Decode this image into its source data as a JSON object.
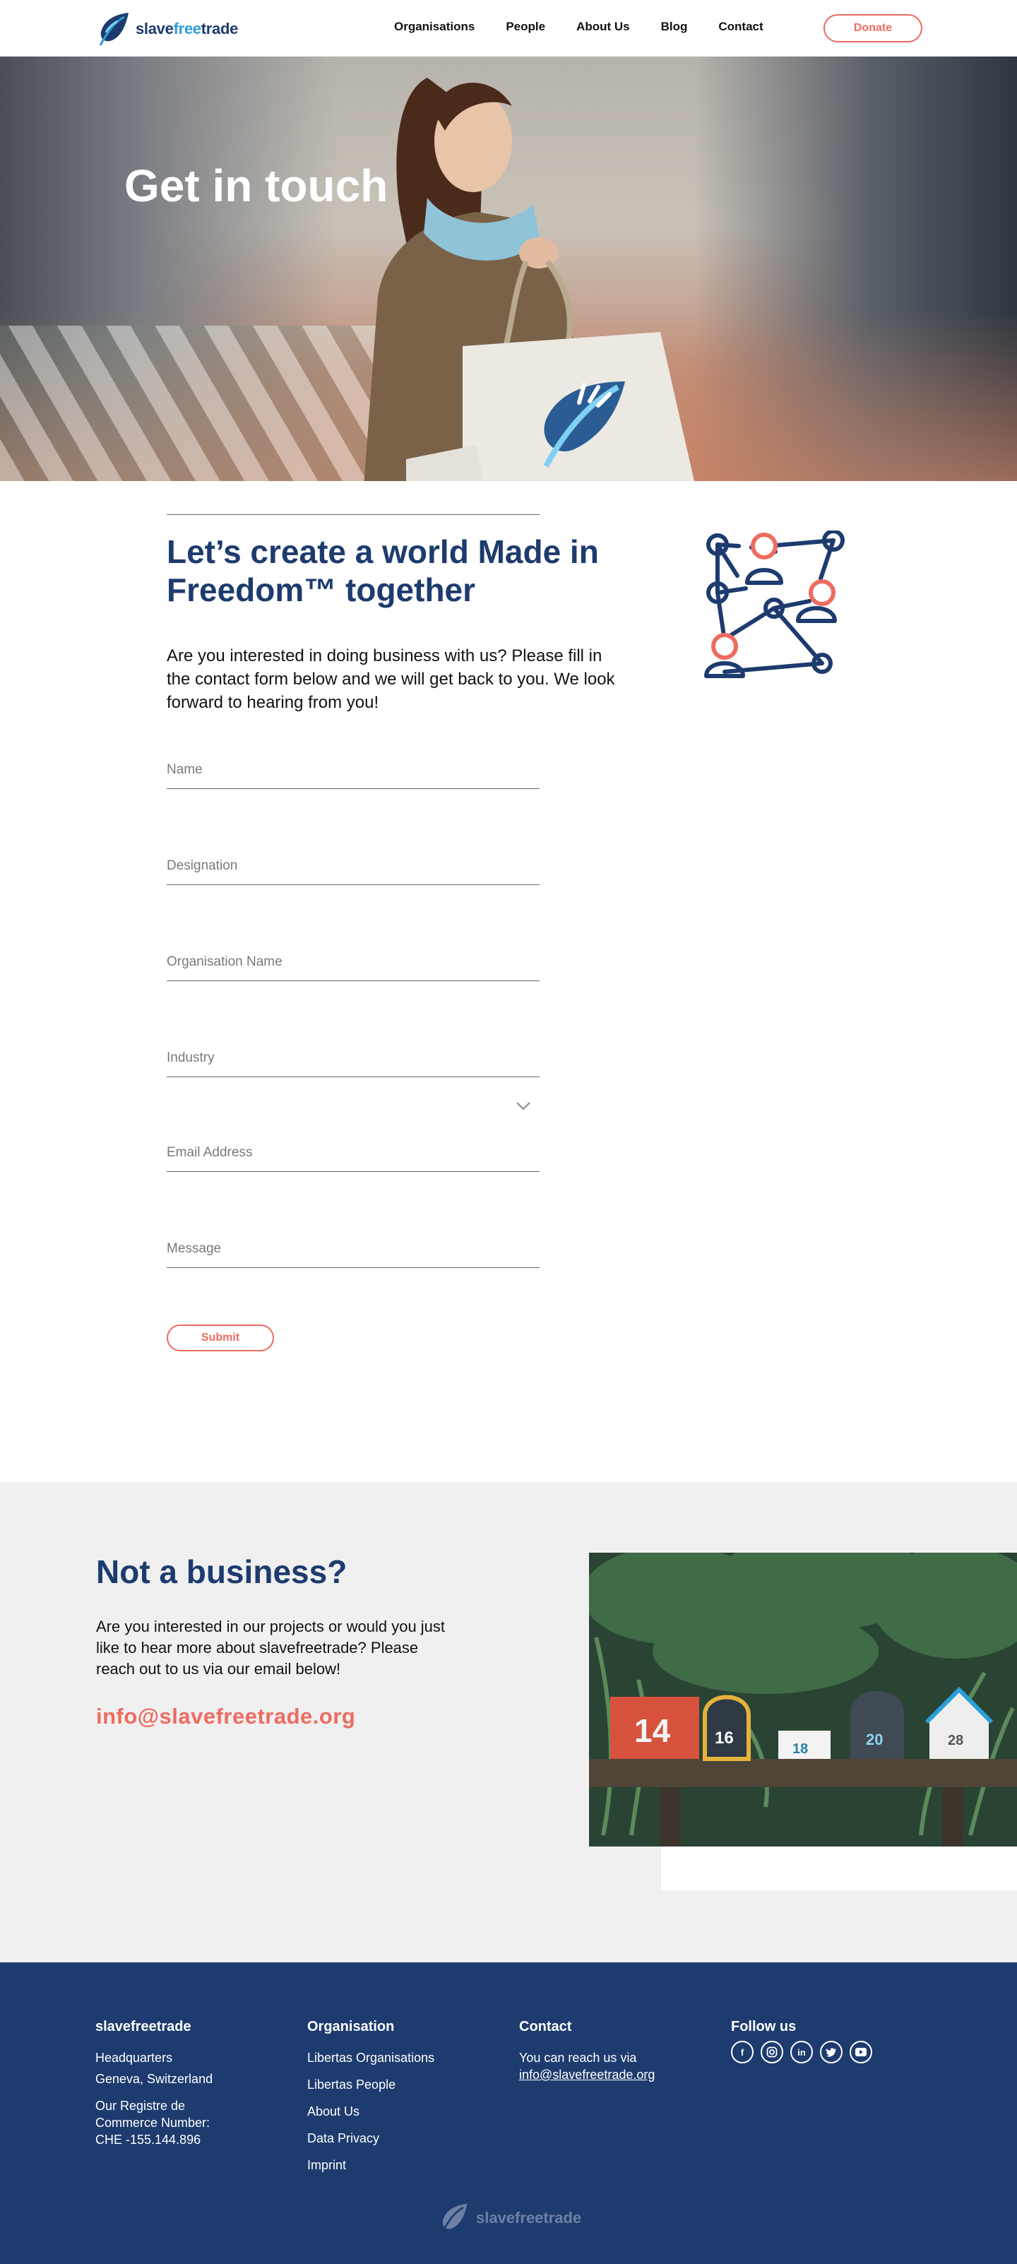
{
  "header": {
    "logo_part1": "slave",
    "logo_part2": "free",
    "logo_part3": "trade",
    "nav": [
      "Organisations",
      "People",
      "About Us",
      "Blog",
      "Contact"
    ],
    "donate_label": "Donate"
  },
  "hero": {
    "title": "Get in touch"
  },
  "intro": {
    "title": "Let’s create a world Made in Freedom™ together",
    "text": "Are you interested in doing business with us? Please fill in the contact form below and we will get back to you. We look forward to hearing from you!"
  },
  "form": {
    "name_placeholder": "Name",
    "designation_placeholder": "Designation",
    "organisation_placeholder": "Organisation Name",
    "industry_placeholder": "Industry",
    "email_placeholder": "Email Address",
    "message_placeholder": "Message",
    "submit_label": "Submit"
  },
  "not_business": {
    "title": "Not a business?",
    "text": "Are you interested in our projects or would you just like to hear more about slavefreetrade? Please reach out to us via our email below!",
    "email": "info@slavefreetrade.org"
  },
  "mailbox_numbers": [
    "14",
    "16",
    "18",
    "20",
    "28"
  ],
  "footer": {
    "brand": "slavefreetrade",
    "hq_line1": "Headquarters",
    "hq_line2": "Geneva, Switzerland",
    "reg_line1": "Our Registre de",
    "reg_line2": "Commerce Number:",
    "reg_line3": "CHE -155.144.896",
    "org_title": "Organisation",
    "org_links": [
      "Libertas Organisations",
      "Libertas People",
      "About Us",
      "Data Privacy",
      "Imprint"
    ],
    "contact_title": "Contact",
    "contact_text": "You can reach us via",
    "contact_email": "info@slavefreetrade.org",
    "follow_title": "Follow us",
    "bottom_logo": "slavefreetrade"
  },
  "colors": {
    "navy": "#1d3b6e",
    "coral": "#ee6b60",
    "light_blue": "#2a9fd8",
    "gray_bg": "#f0f0f0"
  }
}
